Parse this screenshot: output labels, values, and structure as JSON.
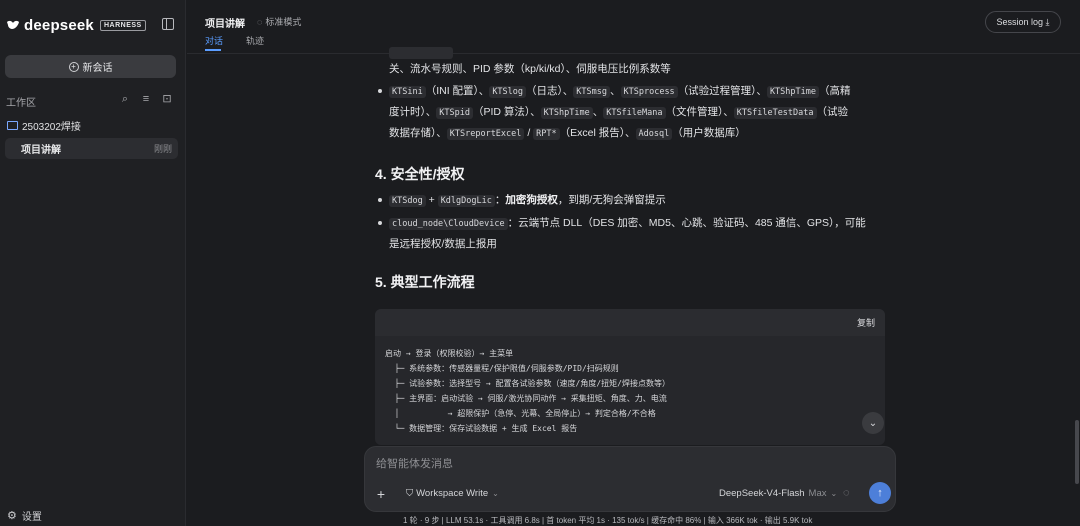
{
  "sidebar": {
    "logo_text": "deepseek",
    "logo_badge": "HARNESS",
    "new_chat_label": "新会话",
    "workspace_label": "工作区",
    "folder_name": "2503202焊接",
    "session_name": "项目讲解",
    "session_time": "刚刚",
    "settings_label": "设置"
  },
  "header": {
    "title": "项目讲解",
    "mode": "标准模式",
    "tab_chat": "对话",
    "tab_trace": "轨迹",
    "session_log": "Session log ⤓"
  },
  "content": {
    "line0": "关、流水号规则、PID 参数（kp/ki/kd）、伺服电压比例系数等",
    "bullet1": {
      "c1": "KTSini",
      "t1": "（INI 配置）、",
      "c2": "KTSlog",
      "t2": "（日志）、",
      "c3": "KTSmsg",
      "t3": "、",
      "c4": "KTSprocess",
      "t4": "（试验过程管理）、",
      "c5": "KTShpTime",
      "t5": "（高精",
      "t6": "度计时）、",
      "c6": "KTSpid",
      "t7": "（PID 算法）、",
      "c7": "KTShpTime",
      "t8": "、",
      "c8": "KTSfileMana",
      "t9": "（文件管理）、",
      "c9": "KTSfileTestData",
      "t10": "（试验",
      "t11": "数据存储）、",
      "c10": "KTSreportExcel",
      "t12": " / ",
      "c11": "RPT*",
      "t13": "（Excel 报告）、",
      "c12": "Adosql",
      "t14": "（用户数据库）"
    },
    "h4": "4. 安全性/授权",
    "bullet2": {
      "c1": "KTSdog",
      "t1": " + ",
      "c2": "KdlgDogLic",
      "t2": "：",
      "b1": "加密狗授权",
      "t3": "，到期/无狗会弹窗提示"
    },
    "bullet3": {
      "c1": "cloud_node\\CloudDevice",
      "t1": "：云端节点 DLL（DES 加密、MD5、心跳、验证码、485 通信、GPS），可能",
      "t2": "是远程授权/数据上报用"
    },
    "h5": "5. 典型工作流程"
  },
  "codeblock": {
    "copy_label": "复制",
    "lines": [
      "启动 → 登录（权限校验）→ 主菜单",
      "  ├─ 系统参数：传感器量程/保护限值/伺服参数/PID/扫码规则",
      "  ├─ 试验参数：选择型号 → 配置各试验参数（速度/角度/扭矩/焊接点数等）",
      "  ├─ 主界面：启动试验 → 伺服/激光协同动作 → 采集扭矩、角度、力、电流",
      "  │          → 超限保护（急停、光幕、全局停止）→ 判定合格/不合格",
      "  └─ 数据管理：保存试验数据 + 生成 Excel 报告"
    ]
  },
  "composer": {
    "placeholder": "给智能体发消息",
    "workspace_write": "Workspace Write",
    "model": "DeepSeek-V4-Flash",
    "model_level": "Max"
  },
  "status_bar": "1 轮 · 9 步  |  LLM 53.1s · 工具调用 6.8s  |  首 token 平均 1s · 135 tok/s  |  缓存命中 86%  |  输入 366K tok · 输出 5.9K tok",
  "colors": {
    "accent": "#5b9dff",
    "send_button": "#4d7fd9",
    "background": "#1b1c1f",
    "sidebar": "#1f2023"
  }
}
